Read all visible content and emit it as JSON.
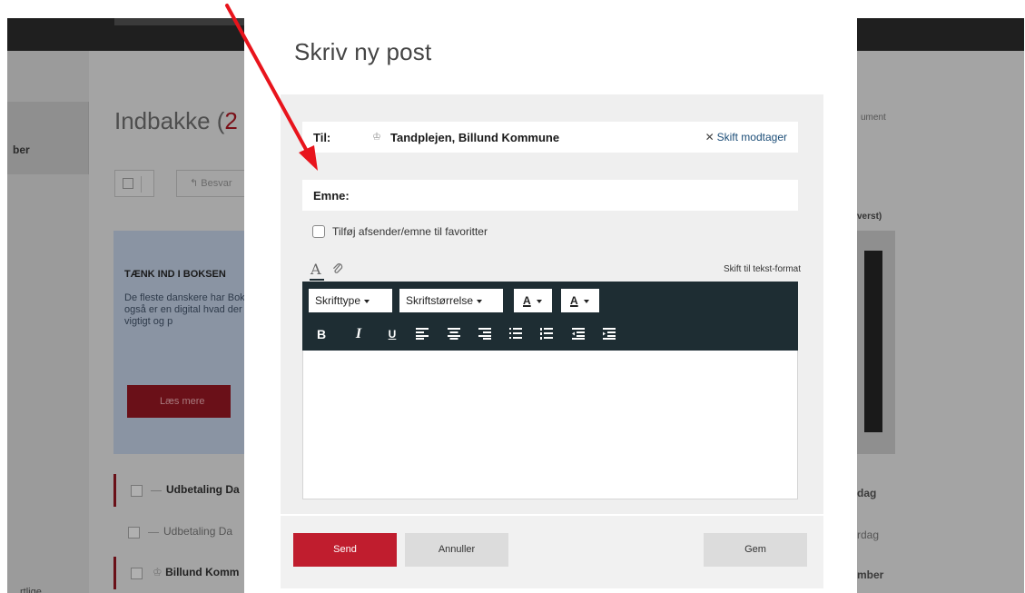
{
  "background": {
    "inbox_title": "Indbakke (",
    "inbox_count": "2",
    "left_nav_fragment": "ber",
    "left_nav_bottom": "rtlige",
    "reply_label": "Besvar",
    "promo": {
      "heading": "TÆNK IND I BOKSEN",
      "body": "De fleste danskere har Boks også er en digital hvad der er vigtigt og p",
      "button": "Læs mere"
    },
    "rows": [
      {
        "label": "Udbetaling Da",
        "right": "dag",
        "bold": true
      },
      {
        "label": "Udbetaling Da",
        "right": "rdag",
        "bold": false
      },
      {
        "label": "Billund Komm",
        "right": "mber",
        "bold": true
      }
    ],
    "right_fragment_top": "ument",
    "right_fragment_sort": "verst)"
  },
  "modal": {
    "title": "Skriv ny post",
    "to_label": "Til:",
    "recipient_icon": "crown-icon",
    "recipient": "Tandplejen, Billund Kommune",
    "change_recipient": "Skift modtager",
    "subject_label": "Emne:",
    "subject_value": "",
    "favorite_label": "Tilføj afsender/emne til favoritter",
    "favorite_checked": false,
    "text_mode_link": "Skift til tekst-format",
    "font_select": "Skrifttype",
    "size_select": "Skriftstørrelse",
    "fore_color": "A",
    "back_color": "A",
    "format_buttons": {
      "bold": "B",
      "italic": "I",
      "underline": "U"
    },
    "body_value": ""
  },
  "footer": {
    "send": "Send",
    "cancel": "Annuller",
    "save": "Gem"
  },
  "colors": {
    "accent_red": "#c01d2e",
    "toolbar_dark": "#1e2d33",
    "link_blue": "#1d4e78",
    "annotation_arrow": "#e8141c"
  }
}
